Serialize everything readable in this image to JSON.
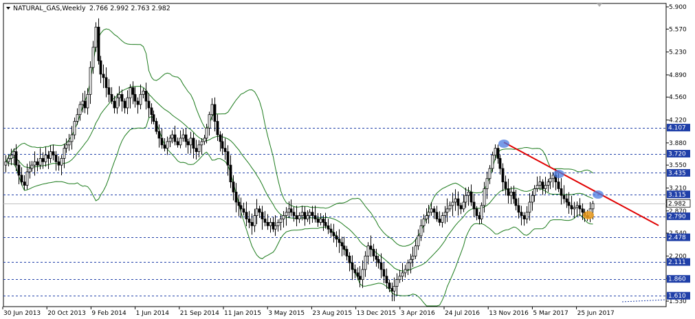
{
  "chart_data": {
    "type": "candlestick",
    "title": "NATURAL_GAS,Weekly",
    "ohlc_text": "2.766 2.992 2.763 2.982",
    "ylim": [
      1.53,
      5.9
    ],
    "price_ticks": [
      "5.900",
      "5.570",
      "5.230",
      "4.890",
      "4.560",
      "4.220",
      "3.880",
      "3.550",
      "3.210",
      "2.870",
      "2.540",
      "2.200",
      "1.870",
      "1.530"
    ],
    "date_ticks": [
      "30 Jun 2013",
      "20 Oct 2013",
      "9 Feb 2014",
      "1 Jun 2014",
      "21 Sep 2014",
      "11 Jan 2015",
      "3 May 2015",
      "23 Aug 2015",
      "13 Dec 2015",
      "3 Apr 2016",
      "24 Jul 2016",
      "13 Nov 2016",
      "5 Mar 2017",
      "25 Jun 2017"
    ],
    "horizontal_levels": [
      {
        "label": "4.107",
        "value": 4.107
      },
      {
        "label": "3.720",
        "value": 3.72
      },
      {
        "label": "3.435",
        "value": 3.435
      },
      {
        "label": "3.115",
        "value": 3.115
      },
      {
        "label": "2.790",
        "value": 2.79
      },
      {
        "label": "2.478",
        "value": 2.478
      },
      {
        "label": "2.111",
        "value": 2.111
      },
      {
        "label": "1.860",
        "value": 1.86
      },
      {
        "label": "1.610",
        "value": 1.61
      }
    ],
    "current_price": {
      "label": "2.982",
      "value": 2.982
    },
    "closes": [
      3.6,
      3.65,
      3.7,
      3.75,
      3.55,
      3.4,
      3.3,
      3.25,
      3.45,
      3.5,
      3.55,
      3.6,
      3.55,
      3.65,
      3.6,
      3.7,
      3.65,
      3.75,
      3.7,
      3.6,
      3.55,
      3.65,
      3.8,
      3.85,
      3.9,
      4.0,
      4.2,
      4.3,
      4.45,
      4.5,
      4.4,
      4.6,
      5.0,
      5.3,
      5.6,
      5.1,
      4.9,
      4.85,
      4.7,
      4.6,
      4.5,
      4.4,
      4.55,
      4.6,
      4.5,
      4.4,
      4.55,
      4.7,
      4.6,
      4.5,
      4.45,
      4.6,
      4.65,
      4.5,
      4.4,
      4.3,
      4.2,
      4.05,
      3.95,
      3.85,
      3.8,
      3.9,
      3.95,
      4.0,
      3.9,
      3.85,
      3.95,
      4.0,
      3.9,
      3.85,
      3.95,
      3.8,
      3.75,
      3.85,
      3.9,
      3.95,
      4.1,
      4.3,
      4.45,
      4.2,
      4.0,
      3.9,
      3.8,
      3.75,
      3.55,
      3.3,
      3.15,
      3.0,
      2.95,
      2.9,
      2.85,
      2.75,
      2.7,
      2.65,
      2.8,
      2.9,
      2.85,
      2.75,
      2.7,
      2.65,
      2.7,
      2.6,
      2.65,
      2.7,
      2.75,
      2.8,
      2.85,
      2.9,
      2.85,
      2.8,
      2.75,
      2.8,
      2.85,
      2.75,
      2.8,
      2.85,
      2.8,
      2.75,
      2.7,
      2.75,
      2.7,
      2.65,
      2.6,
      2.55,
      2.5,
      2.45,
      2.4,
      2.35,
      2.3,
      2.2,
      2.1,
      2.0,
      1.95,
      1.9,
      1.85,
      2.0,
      2.2,
      2.35,
      2.3,
      2.2,
      2.15,
      2.1,
      2.0,
      1.9,
      1.8,
      1.72,
      1.68,
      1.75,
      1.85,
      1.9,
      1.95,
      2.0,
      2.1,
      2.15,
      2.2,
      2.35,
      2.5,
      2.65,
      2.75,
      2.8,
      2.85,
      2.9,
      2.85,
      2.75,
      2.7,
      2.8,
      2.85,
      2.9,
      2.95,
      3.0,
      3.05,
      2.95,
      2.9,
      3.0,
      3.1,
      3.15,
      3.0,
      2.9,
      2.8,
      2.75,
      2.95,
      3.2,
      3.35,
      3.5,
      3.7,
      3.8,
      3.65,
      3.5,
      3.3,
      3.2,
      3.1,
      3.15,
      3.05,
      2.95,
      2.85,
      2.8,
      2.75,
      2.85,
      3.0,
      3.1,
      3.2,
      3.25,
      3.3,
      3.2,
      3.25,
      3.3,
      3.35,
      3.4,
      3.3,
      3.2,
      3.1,
      3.05,
      3.0,
      2.95,
      2.9,
      2.92,
      2.95,
      2.9,
      2.85,
      2.8,
      2.77,
      2.9,
      2.98
    ]
  }
}
